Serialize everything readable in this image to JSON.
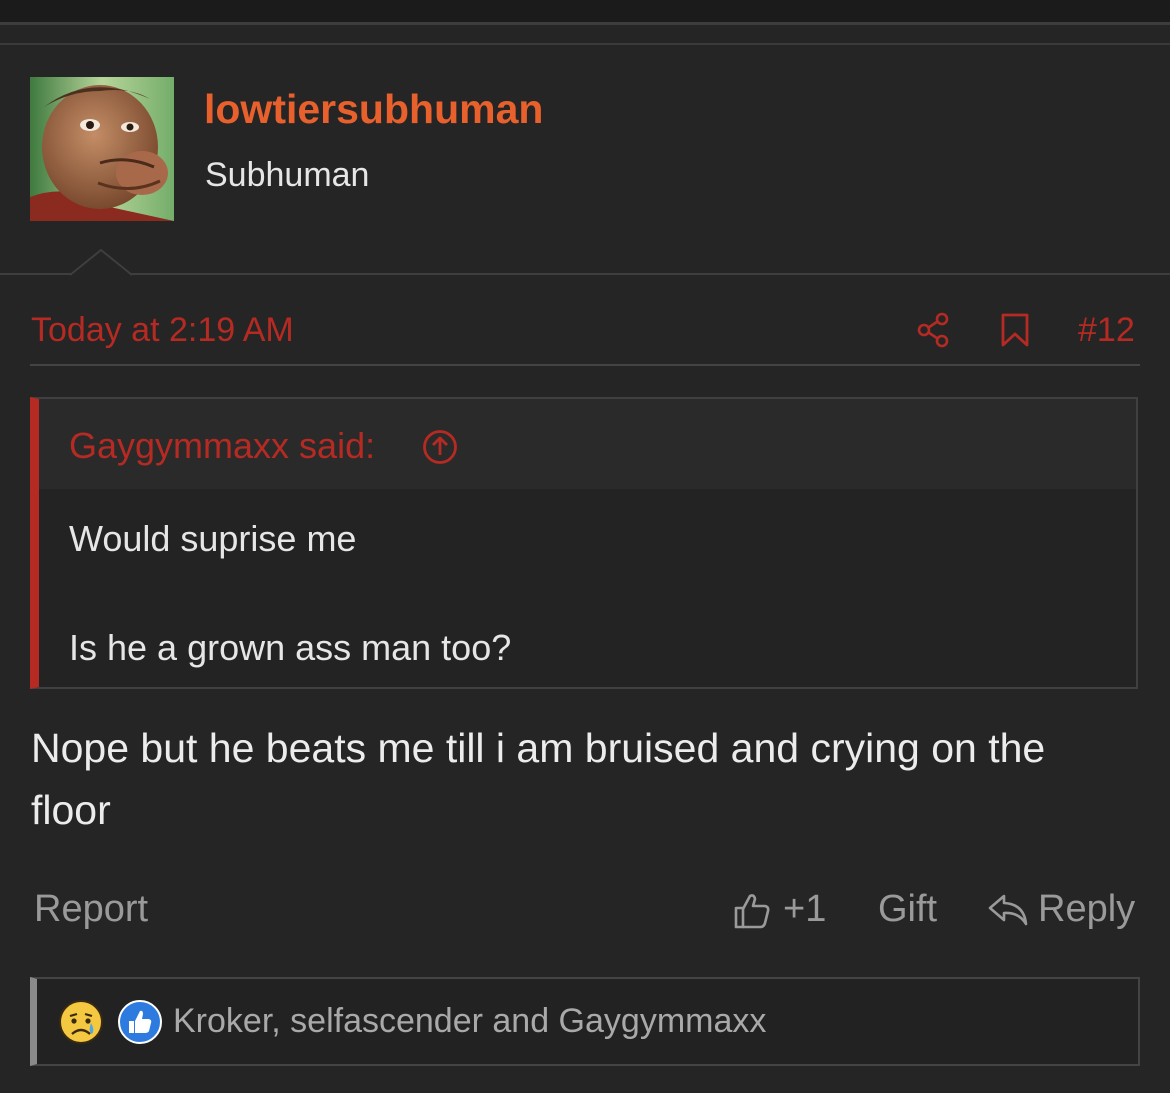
{
  "colors": {
    "background": "#252526",
    "accent_orange": "#e8602c",
    "accent_red": "#b52a22",
    "text_primary": "#ececec",
    "text_muted": "#9a9a9a"
  },
  "post": {
    "author": {
      "username": "lowtiersubhuman",
      "title": "Subhuman",
      "avatar": "cartoon-face-avatar"
    },
    "header": {
      "timestamp": "Today at 2:19 AM",
      "share_icon": "share-icon",
      "bookmark_icon": "bookmark-icon",
      "post_number": "#12"
    },
    "quote": {
      "author_label": "Gaygymmaxx said:",
      "jump_icon": "arrow-up-circle-icon",
      "lines": [
        "Would suprise me",
        "Is he a grown ass man too?"
      ]
    },
    "body": "Nope but he beats me till i am bruised and crying on the floor",
    "actions": {
      "report": "Report",
      "like_icon": "thumbs-up-icon",
      "like_count": "+1",
      "gift": "Gift",
      "reply_icon": "reply-arrow-icon",
      "reply": "Reply"
    },
    "reactions": {
      "icons": [
        "sad-emoji-icon",
        "like-reaction-icon"
      ],
      "users": "Kroker, selfascender and Gaygymmaxx"
    }
  }
}
